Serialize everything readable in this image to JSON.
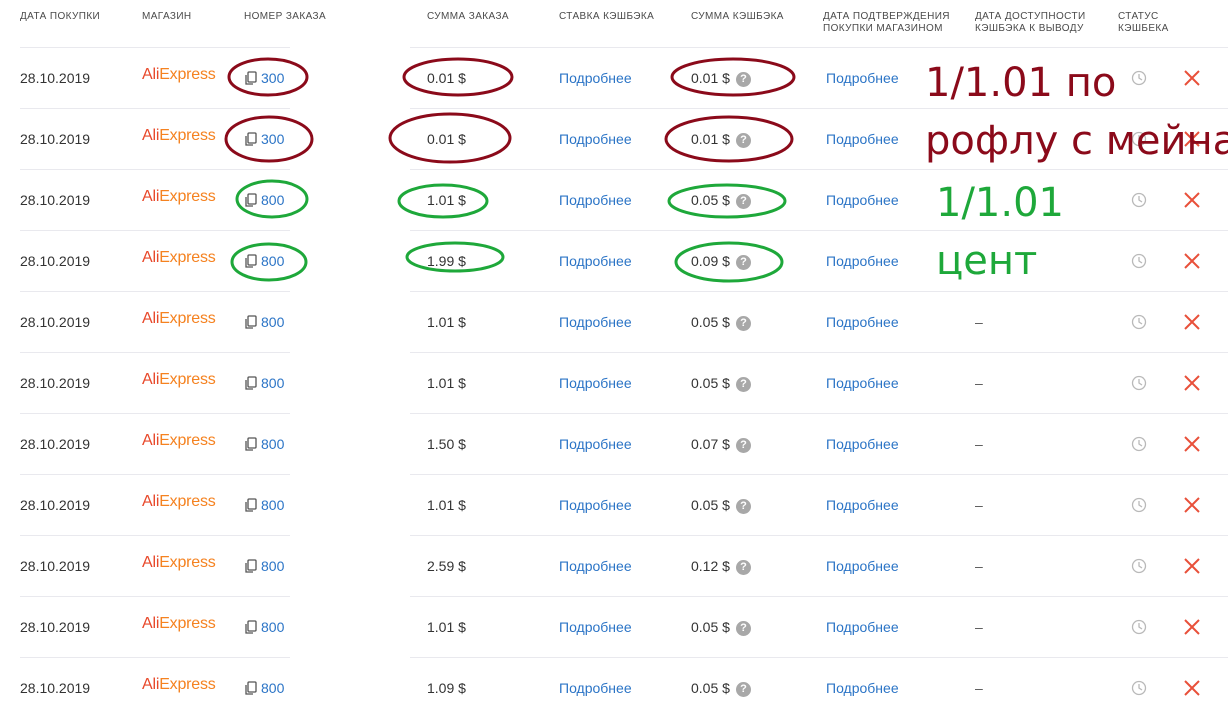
{
  "headers": {
    "date": "ДАТА ПОКУПКИ",
    "store": "МАГАЗИН",
    "order": "НОМЕР ЗАКАЗА",
    "sum": "СУММА ЗАКАЗА",
    "rate": "СТАВКА КЭШБЭКА",
    "cashback": "СУММА КЭШБЭКА",
    "confirm": "ДАТА ПОДТВЕРЖДЕНИЯ\nПОКУПКИ МАГАЗИНОМ",
    "available": "ДАТА ДОСТУПНОСТИ\nКЭШБЭКА К ВЫВОДУ",
    "status": "СТАТУС\nКЭШБЕКА"
  },
  "rows": [
    {
      "date": "28.10.2019",
      "store_a": "Ali",
      "store_b": "Express",
      "order": "300",
      "sum": "0.01 $",
      "rate": "Подробнее",
      "cashback": "0.01 $",
      "confirm": "Подробнее",
      "available": ""
    },
    {
      "date": "28.10.2019",
      "store_a": "Ali",
      "store_b": "Express",
      "order": "300",
      "sum": "0.01 $",
      "rate": "Подробнее",
      "cashback": "0.01 $",
      "confirm": "Подробнее",
      "available": ""
    },
    {
      "date": "28.10.2019",
      "store_a": "Ali",
      "store_b": "Express",
      "order": "800",
      "sum": "1.01 $",
      "rate": "Подробнее",
      "cashback": "0.05 $",
      "confirm": "Подробнее",
      "available": ""
    },
    {
      "date": "28.10.2019",
      "store_a": "Ali",
      "store_b": "Express",
      "order": "800",
      "sum": "1.99 $",
      "rate": "Подробнее",
      "cashback": "0.09 $",
      "confirm": "Подробнее",
      "available": ""
    },
    {
      "date": "28.10.2019",
      "store_a": "Ali",
      "store_b": "Express",
      "order": "800",
      "sum": "1.01 $",
      "rate": "Подробнее",
      "cashback": "0.05 $",
      "confirm": "Подробнее",
      "available": "–"
    },
    {
      "date": "28.10.2019",
      "store_a": "Ali",
      "store_b": "Express",
      "order": "800",
      "sum": "1.01 $",
      "rate": "Подробнее",
      "cashback": "0.05 $",
      "confirm": "Подробнее",
      "available": "–"
    },
    {
      "date": "28.10.2019",
      "store_a": "Ali",
      "store_b": "Express",
      "order": "800",
      "sum": "1.50 $",
      "rate": "Подробнее",
      "cashback": "0.07 $",
      "confirm": "Подробнее",
      "available": "–"
    },
    {
      "date": "28.10.2019",
      "store_a": "Ali",
      "store_b": "Express",
      "order": "800",
      "sum": "1.01 $",
      "rate": "Подробнее",
      "cashback": "0.05 $",
      "confirm": "Подробнее",
      "available": "–"
    },
    {
      "date": "28.10.2019",
      "store_a": "Ali",
      "store_b": "Express",
      "order": "800",
      "sum": "2.59 $",
      "rate": "Подробнее",
      "cashback": "0.12 $",
      "confirm": "Подробнее",
      "available": "–"
    },
    {
      "date": "28.10.2019",
      "store_a": "Ali",
      "store_b": "Express",
      "order": "800",
      "sum": "1.01 $",
      "rate": "Подробнее",
      "cashback": "0.05 $",
      "confirm": "Подробнее",
      "available": "–"
    },
    {
      "date": "28.10.2019",
      "store_a": "Ali",
      "store_b": "Express",
      "order": "800",
      "sum": "1.09 $",
      "rate": "Подробнее",
      "cashback": "0.05 $",
      "confirm": "Подробнее",
      "available": "–"
    }
  ],
  "row_icons": {
    "order": "copy-icon",
    "cashback": "question-icon",
    "status": "clock-icon",
    "action": "close-icon"
  },
  "annotations": {
    "red_line1": "1/1.01 по",
    "red_line2": "рофлу с мейна",
    "green_line1": "1/1.01",
    "green_line2": "цент"
  },
  "colors": {
    "link": "#2b74c6",
    "delete": "#e8503a",
    "annotation_red": "#8b0a1a",
    "annotation_green": "#1ea83a",
    "brand_ali": "#e8482a",
    "brand_express": "#f58220"
  }
}
